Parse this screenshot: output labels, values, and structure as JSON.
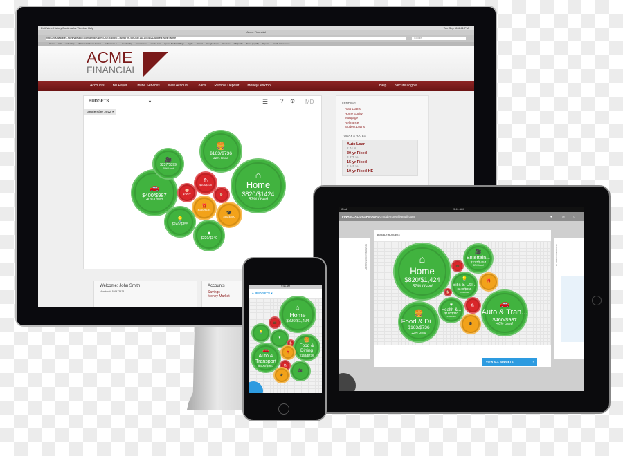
{
  "imac": {
    "menubar": [
      "Edit",
      "View",
      "History",
      "Bookmarks",
      "Window",
      "Help"
    ],
    "clock": "Tue Sep 11 6:41 PM",
    "window_title": "Acme Financial",
    "url": "https://qa-batcave1.moneydesktop.com/amigo/users/USR-45d5b21-5605-f7f6-9902-8716a1f0c4b21/widgets?style=acme",
    "search_placeholder": "Google",
    "bookmarks": [
      "Home",
      "AXA - Leadership",
      "McCann Erickson Center",
      "11 Success F...",
      "Leadership",
      "Comcast.net",
      "mathe.com",
      "Speed Me Start Page",
      "Apple",
      "Yahoo!",
      "Google Maps",
      "YouTube",
      "Wikipedia",
      "News (1,016)",
      "Popular",
      "Credit Union Issue"
    ],
    "logo_top": "ACME",
    "logo_bottom": "FINANCIAL",
    "nav": [
      "Accounts",
      "Bill Payer",
      "Online Services",
      "New Account",
      "Loans",
      "Remote Deposit",
      "MoneyDesktop"
    ],
    "nav_right": [
      "Help",
      "Secure Logout"
    ],
    "widget": {
      "title": "BUDGETS",
      "month": "September 2012",
      "brand": "MD",
      "bubbles": [
        {
          "icon": "car",
          "amount": "$400/$987",
          "used": "40% Used",
          "status": "green"
        },
        {
          "icon": "video-camera",
          "amount": "$237/$399",
          "used": "59% Used",
          "status": "green"
        },
        {
          "icon": "burger",
          "amount": "$163/$736",
          "used": "22% Used",
          "status": "green"
        },
        {
          "label": "Home",
          "icon": "house",
          "amount": "$820/$1424",
          "used": "57% Used",
          "status": "green"
        },
        {
          "icon": "piggy-bank",
          "amount": "$79/$77",
          "status": "red"
        },
        {
          "icon": "shopping-bag",
          "amount": "$108/$105",
          "status": "red"
        },
        {
          "icon": "dog",
          "status": "red"
        },
        {
          "icon": "gift",
          "amount": "$160/$194",
          "status": "orange"
        },
        {
          "icon": "graduation-cap",
          "amount": "$90/$200",
          "status": "orange"
        },
        {
          "icon": "light-bulb",
          "amount": "$240/$355",
          "status": "green"
        },
        {
          "icon": "heart",
          "amount": "$220/$340",
          "status": "green"
        }
      ]
    },
    "lending": {
      "title": "LENDING",
      "links": [
        "Auto Loans",
        "Home Equity",
        "Mortgage",
        "Refinance",
        "Student Loans"
      ]
    },
    "rates": {
      "title": "TODAY'S RATES",
      "items": [
        {
          "name": "Auto Loan",
          "rate": "2.74 %"
        },
        {
          "name": "30-yr Fixed",
          "rate": "3.375 %"
        },
        {
          "name": "15-yr Fixed",
          "rate": "2.645 %"
        },
        {
          "name": "10-yr Fixed HE"
        }
      ]
    },
    "welcome": {
      "title": "Welcome: John Smith",
      "member": "Member #: 526473423"
    },
    "accounts": {
      "title": "Accounts",
      "links": [
        "Savings",
        "Money Market"
      ]
    }
  },
  "ipad": {
    "carrier": "iPad",
    "time": "9:41 AM",
    "header": "FINANCIAL DASHBOARD:",
    "email": "mddemo05@gmail.com",
    "card_title": "BUBBLE BUDGETS",
    "left_panel": "SPENDING BY CATEGORY",
    "right_panel": "SPENDING BY MONTH",
    "view_all": "VIEW ALL BUDGETS",
    "bubbles": [
      {
        "label": "Home",
        "icon": "house",
        "amount": "$820/$1,424",
        "used": "57% Used",
        "status": "green"
      },
      {
        "label": "Entertain...",
        "icon": "video-camera",
        "amount": "$237/$454",
        "used": "52% Used",
        "status": "green"
      },
      {
        "icon": "briefcase",
        "status": "red"
      },
      {
        "label": "Bills & Util...",
        "icon": "light-bulb",
        "amount": "$240/$355",
        "used": "67% Used",
        "status": "green"
      },
      {
        "icon": "gift",
        "status": "orange"
      },
      {
        "icon": "dog",
        "status": "red"
      },
      {
        "label": "Health &...",
        "icon": "heart",
        "amount": "$160/$340",
        "used": "47% Used",
        "status": "green"
      },
      {
        "icon": "shopping-bag",
        "status": "red"
      },
      {
        "label": "Auto & Tran...",
        "icon": "car",
        "amount": "$460/$987",
        "used": "46% Used",
        "status": "green"
      },
      {
        "label": "Food & Di...",
        "icon": "burger",
        "amount": "$163/$736",
        "used": "22% Used",
        "status": "green"
      },
      {
        "icon": "graduation-cap",
        "status": "orange"
      }
    ]
  },
  "iphone": {
    "time": "9:41 AM",
    "title": "BUDGETS",
    "bubbles": [
      {
        "label": "Home",
        "icon": "house",
        "amount": "$820/$1,424",
        "status": "green"
      },
      {
        "icon": "briefcase",
        "status": "red"
      },
      {
        "icon": "light-bulb",
        "status": "green"
      },
      {
        "icon": "heart",
        "status": "green"
      },
      {
        "icon": "dog",
        "status": "red"
      },
      {
        "label": "Food & Dining",
        "icon": "burger",
        "amount": "$163/$736",
        "status": "green"
      },
      {
        "label": "Auto & Transport",
        "icon": "car",
        "amount": "$400/$987",
        "status": "green"
      },
      {
        "icon": "gift",
        "status": "orange"
      },
      {
        "icon": "shopping-bag",
        "status": "red"
      },
      {
        "icon": "video-camera",
        "status": "green"
      },
      {
        "icon": "graduation-cap",
        "status": "orange"
      }
    ]
  },
  "colors": {
    "brand": "#7a1a1a",
    "green": "#41b33f",
    "red": "#d9262a",
    "orange": "#f2a21a",
    "blue": "#2d9be0"
  }
}
